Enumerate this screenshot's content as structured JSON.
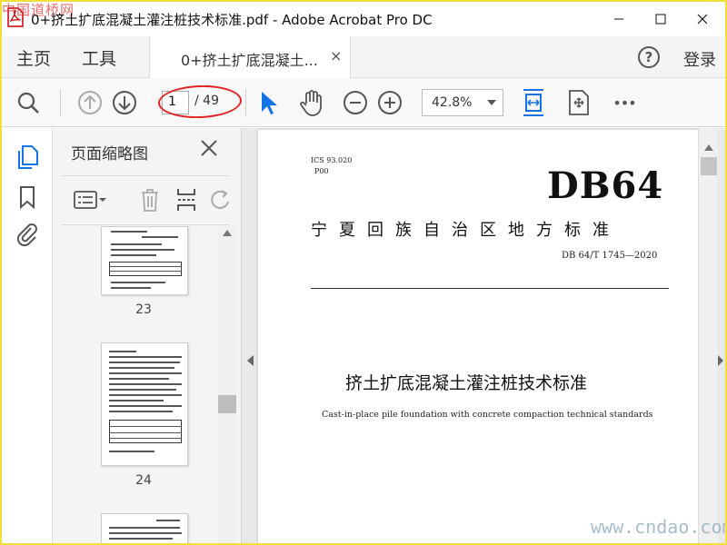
{
  "window": {
    "title": "0+挤土扩底混凝土灌注桩技术标准.pdf - Adobe Acrobat Pro DC",
    "watermark_top_left": "中国道桥网"
  },
  "menu": {
    "home": "主页",
    "tools": "工具"
  },
  "doc_tab": {
    "label": "0+挤土扩底混凝土...",
    "close": "×"
  },
  "header_right": {
    "help": "?",
    "login": "登录"
  },
  "toolbar": {
    "page_current": "1",
    "page_total": "/ 49",
    "zoom": "42.8%",
    "more": "•••"
  },
  "thumbnails_panel": {
    "title": "页面缩略图",
    "pages": [
      {
        "number": "23"
      },
      {
        "number": "24"
      }
    ]
  },
  "document": {
    "ics": "ICS 93.020",
    "class_code": "P00",
    "code": "DB64",
    "org": "宁夏回族自治区地方标准",
    "std_no": "DB 64/T 1745—2020",
    "title_cn": "挤土扩底混凝土灌注桩技术标准",
    "title_en": "Cast-in-place pile foundation with concrete compaction technical standards"
  },
  "watermark_bottom_right": "www.cndao.com",
  "colors": {
    "accent_blue": "#1473e6",
    "ellipse_red": "#e22424",
    "frame_yellow": "#f3df3a"
  }
}
